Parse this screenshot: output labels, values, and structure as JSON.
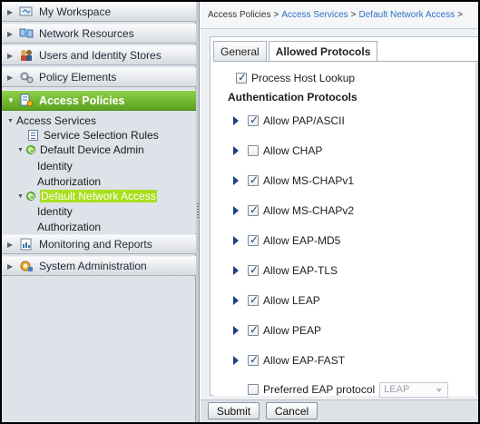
{
  "sidebar": {
    "drawers": [
      {
        "label": "My Workspace",
        "icon": "workspace-icon"
      },
      {
        "label": "Network Resources",
        "icon": "network-resources-icon"
      },
      {
        "label": "Users and Identity Stores",
        "icon": "users-icon"
      },
      {
        "label": "Policy Elements",
        "icon": "policy-elements-icon"
      },
      {
        "label": "Access Policies",
        "icon": "access-policies-icon",
        "active": true
      },
      {
        "label": "Monitoring and Reports",
        "icon": "monitoring-icon"
      },
      {
        "label": "System Administration",
        "icon": "system-admin-icon"
      }
    ],
    "tree": {
      "access_services": "Access Services",
      "service_selection_rules": "Service Selection Rules",
      "default_device_admin": "Default Device Admin",
      "dda_identity": "Identity",
      "dda_authorization": "Authorization",
      "default_network_access": "Default Network Access",
      "dna_identity": "Identity",
      "dna_authorization": "Authorization"
    }
  },
  "breadcrumb": {
    "part1": "Access Policies",
    "sep": ">",
    "part2": "Access Services",
    "part3": "Default Network Access",
    "part4": ">"
  },
  "tabs": [
    {
      "label": "General"
    },
    {
      "label": "Allowed Protocols",
      "active": true
    }
  ],
  "form": {
    "process_host_lookup": {
      "label": "Process Host Lookup",
      "checked": true
    },
    "auth_heading": "Authentication Protocols",
    "protocols": [
      {
        "label": "Allow PAP/ASCII",
        "checked": true
      },
      {
        "label": "Allow CHAP",
        "checked": false
      },
      {
        "label": "Allow MS-CHAPv1",
        "checked": true
      },
      {
        "label": "Allow MS-CHAPv2",
        "checked": true
      },
      {
        "label": "Allow EAP-MD5",
        "checked": true
      },
      {
        "label": "Allow EAP-TLS",
        "checked": true
      },
      {
        "label": "Allow LEAP",
        "checked": true
      },
      {
        "label": "Allow PEAP",
        "checked": true
      },
      {
        "label": "Allow EAP-FAST",
        "checked": true
      }
    ],
    "preferred_eap": {
      "label": "Preferred EAP protocol",
      "checked": false,
      "value": "LEAP"
    }
  },
  "buttons": {
    "submit": "Submit",
    "cancel": "Cancel"
  },
  "colors": {
    "accent": "#6bb52a",
    "link": "#2a73c5",
    "selected_node": "#a7e01c"
  }
}
